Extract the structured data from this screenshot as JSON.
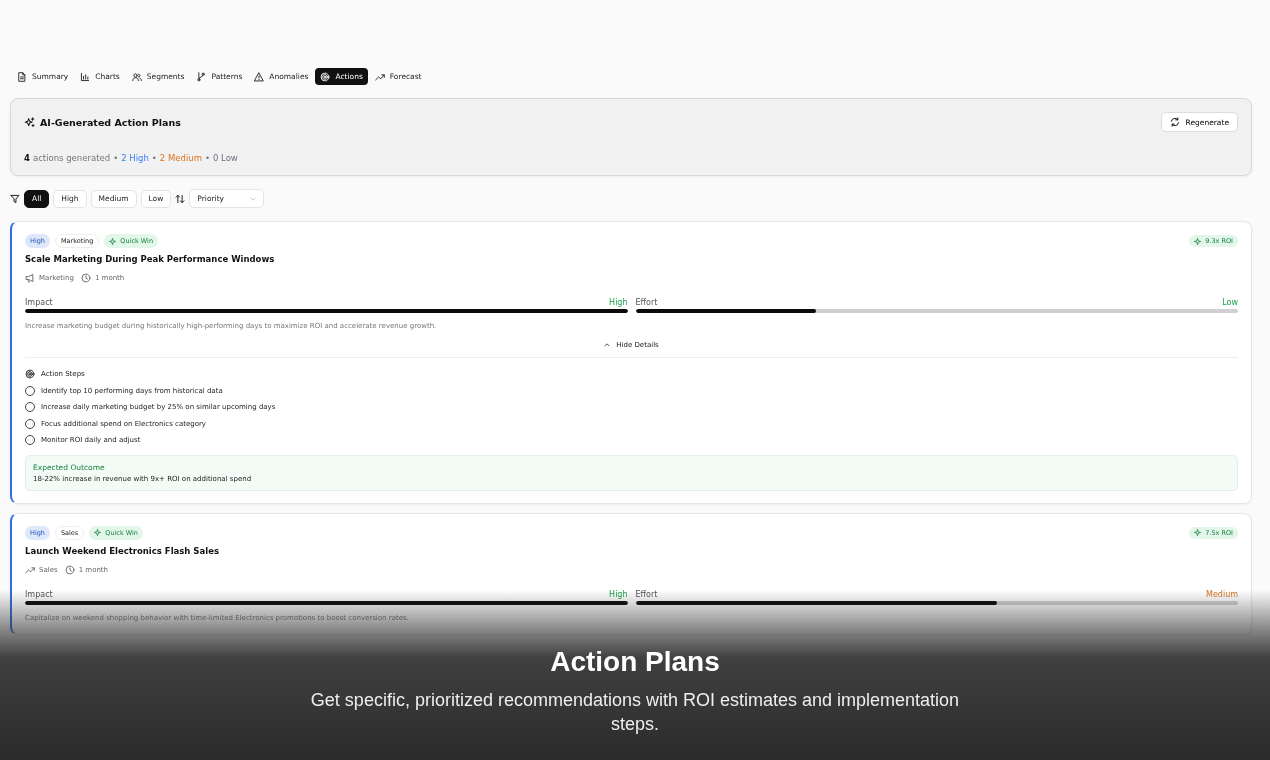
{
  "tabs": [
    {
      "label": "Summary",
      "selected": false
    },
    {
      "label": "Charts",
      "selected": false
    },
    {
      "label": "Segments",
      "selected": false
    },
    {
      "label": "Patterns",
      "selected": false
    },
    {
      "label": "Anomalies",
      "selected": false
    },
    {
      "label": "Actions",
      "selected": true
    },
    {
      "label": "Forecast",
      "selected": false
    }
  ],
  "header": {
    "title": "AI-Generated Action Plans",
    "button": "Regenerate",
    "count": "4",
    "count_text": "actions generated",
    "parts": [
      {
        "sep": "•",
        "text": "2 High",
        "kind": "high"
      },
      {
        "sep": "•",
        "text": "2 Medium",
        "kind": "medium"
      },
      {
        "sep": "•",
        "text": "0 Low",
        "kind": "low"
      }
    ]
  },
  "filters": [
    {
      "label": "All",
      "selected": true
    },
    {
      "label": "High",
      "selected": false
    },
    {
      "label": "Medium",
      "selected": false
    },
    {
      "label": "Low",
      "selected": false
    }
  ],
  "sort": {
    "value": "Priority"
  },
  "actions": [
    {
      "priority": "High",
      "category": "Marketing",
      "quick_win": "Quick Win",
      "roi": "9.3x ROI",
      "title": "Scale Marketing During Peak Performance Windows",
      "meta_category": "Marketing",
      "duration": "1 month",
      "impact": {
        "label": "Impact",
        "rating": "High",
        "kind": "good",
        "level": 1.0
      },
      "effort": {
        "label": "Effort",
        "rating": "Low",
        "kind": "good",
        "level": 0.3
      },
      "description": "Increase marketing budget during historically high-performing days to maximize ROI and accelerate revenue growth.",
      "toggle": "Hide Details",
      "expanded": true,
      "steps_title": "Action Steps",
      "steps": [
        {
          "text": "Identify top 10 performing days from historical data",
          "checked": false
        },
        {
          "text": "Increase daily marketing budget by 25% on similar upcoming days",
          "checked": false
        },
        {
          "text": "Focus additional spend on Electronics category",
          "checked": false
        },
        {
          "text": "Monitor ROI daily and adjust",
          "checked": false
        }
      ],
      "outcome_title": "Expected Outcome",
      "outcome": "18-22% increase in revenue with 9x+ ROI on additional spend"
    },
    {
      "priority": "High",
      "category": "Sales",
      "quick_win": "Quick Win",
      "roi": "7.5x ROI",
      "title": "Launch Weekend Electronics Flash Sales",
      "meta_category": "Sales",
      "duration": "1 month",
      "impact": {
        "label": "Impact",
        "rating": "High",
        "kind": "good",
        "level": 1.0
      },
      "effort": {
        "label": "Effort",
        "rating": "Medium",
        "kind": "fair",
        "level": 0.6
      },
      "description": "Capitalize on weekend shopping behavior with time-limited Electronics promotions to boost conversion rates.",
      "expanded": false
    }
  ],
  "caption": {
    "title": "Action Plans",
    "subtitle": "Get specific, prioritized recommendations with ROI estimates and implementation steps."
  }
}
